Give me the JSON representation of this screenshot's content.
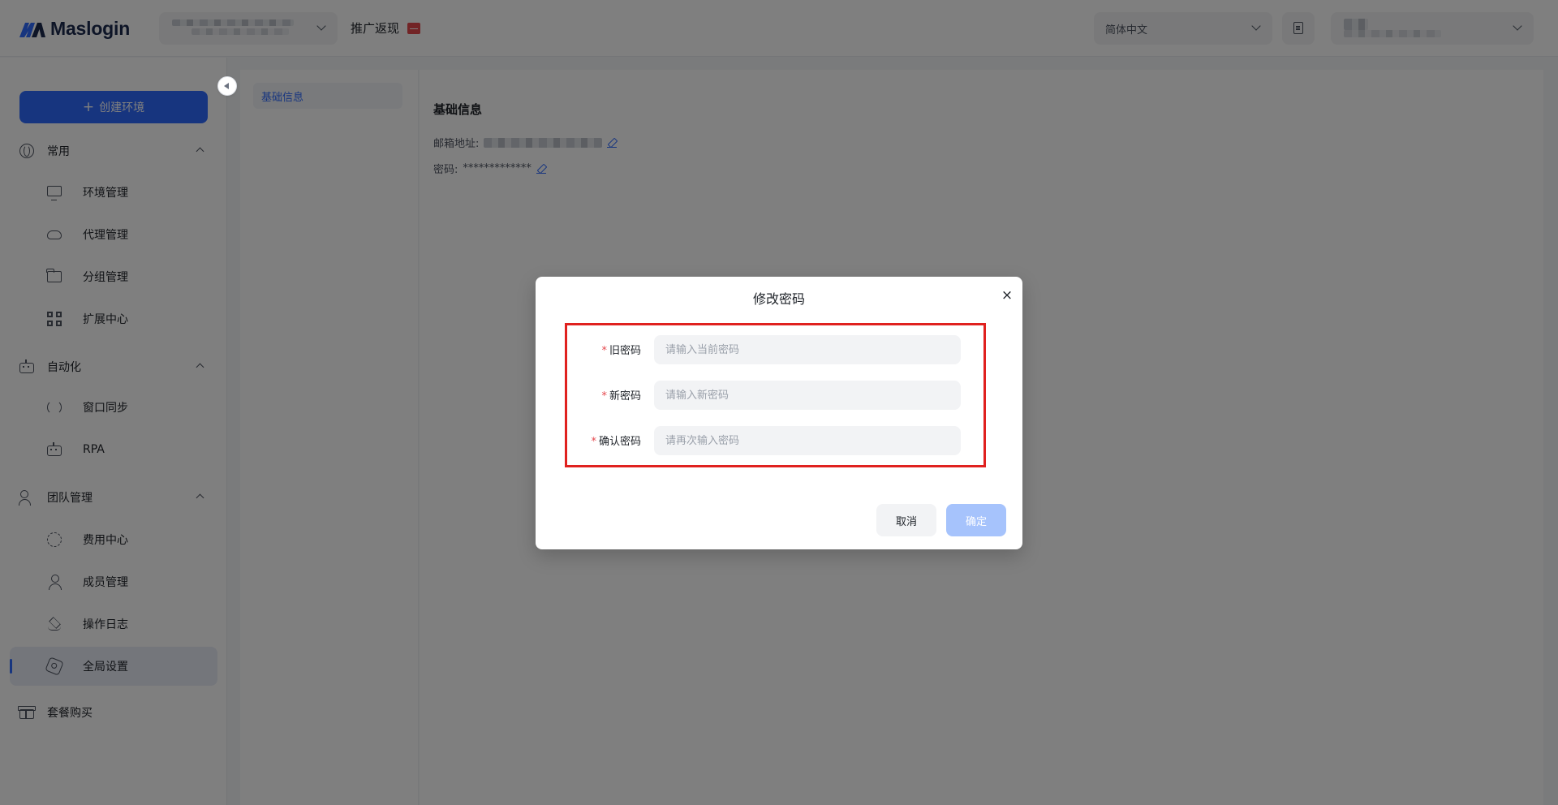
{
  "header": {
    "brand": "Maslogin",
    "promo_label": "推广返现",
    "language": "简体中文"
  },
  "sidebar": {
    "create_label": "创建环境",
    "groups": [
      {
        "label": "常用",
        "items": [
          "环境管理",
          "代理管理",
          "分组管理",
          "扩展中心"
        ]
      },
      {
        "label": "自动化",
        "items": [
          "窗口同步",
          "RPA"
        ]
      },
      {
        "label": "团队管理",
        "items": [
          "费用中心",
          "成员管理",
          "操作日志",
          "全局设置"
        ]
      }
    ],
    "bottom_item": "套餐购买",
    "active_item": "全局设置"
  },
  "settings": {
    "tab_active": "基础信息",
    "section_title": "基础信息",
    "email_label": "邮箱地址:",
    "password_label": "密码:",
    "password_mask": "*************"
  },
  "dialog": {
    "title": "修改密码",
    "close_symbol": "×",
    "fields": [
      {
        "label": "旧密码",
        "placeholder": "请输入当前密码",
        "value": ""
      },
      {
        "label": "新密码",
        "placeholder": "请输入新密码",
        "value": ""
      },
      {
        "label": "确认密码",
        "placeholder": "请再次输入密码",
        "value": ""
      }
    ],
    "required_mark": "*",
    "cancel_label": "取消",
    "confirm_label": "确定"
  },
  "colors": {
    "primary": "#2f6bff",
    "confirm_disabled": "#a6c3fc",
    "highlight": "#e0211f",
    "required": "#e5484d"
  }
}
